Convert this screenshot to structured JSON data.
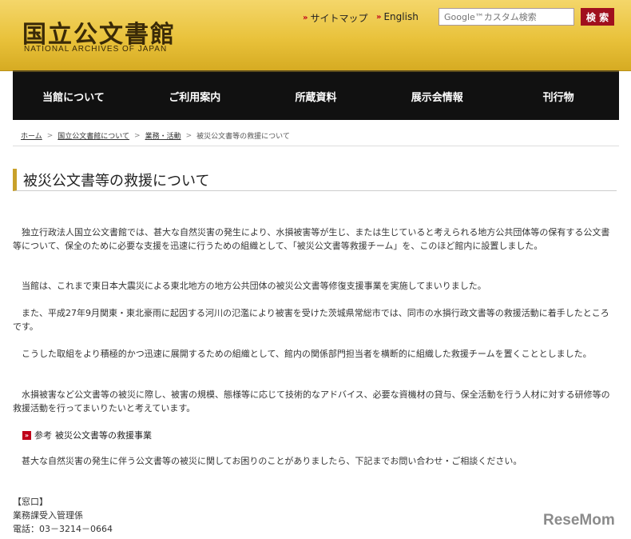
{
  "header": {
    "logo_jp": "国立公文書館",
    "logo_en": "NATIONAL ARCHIVES OF JAPAN",
    "sitemap_label": "サイトマップ",
    "english_label": "English",
    "search_placeholder": "Google™カスタム検索",
    "search_button": "検 索"
  },
  "nav": {
    "items": [
      "当館について",
      "ご利用案内",
      "所蔵資料",
      "展示会情報",
      "刊行物"
    ]
  },
  "breadcrumb": {
    "items": [
      "ホーム",
      "国立公文書館について",
      "業務・活動",
      "被災公文書等の救援について"
    ],
    "separator": ">"
  },
  "page": {
    "title": "被災公文書等の救援について",
    "paragraphs": [
      "独立行政法人国立公文書館では、甚大な自然災害の発生により、水損被害等が生じ、または生じていると考えられる地方公共団体等の保有する公文書等について、保全のために必要な支援を迅速に行うための組織として、「被災公文書等救援チーム」を、このほど館内に設置しました。",
      "当館は、これまで東日本大震災による東北地方の地方公共団体の被災公文書等修復支援事業を実施してまいりました。",
      "また、平成27年9月関東・東北豪雨に起因する河川の氾濫により被害を受けた茨城県常総市では、同市の水損行政文書等の救援活動に着手したところです。",
      "こうした取組をより積極的かつ迅速に展開するための組織として、館内の関係部門担当者を横断的に組織した救援チームを置くこととしました。",
      "水損被害など公文書等の被災に際し、被害の規模、態様等に応じて技術的なアドバイス、必要な資機材の貸与、保全活動を行う人材に対する研修等の救援活動を行ってまいりたいと考えています。"
    ],
    "reference_prefix": "参考",
    "reference_link": "被災公文書等の救援事業",
    "closing": "甚大な自然災害の発生に伴う公文書等の被災に関してお困りのことがありましたら、下記までお問い合わせ・ご相談ください。"
  },
  "contact": {
    "heading": "【窓口】",
    "department": "業務課受入管理係",
    "phone": "電話：03－3214－0664"
  },
  "watermark": {
    "text_a": "Rese",
    "text_b": "Mom"
  },
  "colors": {
    "header_gold": "#e9c23b",
    "nav_black": "#111111",
    "accent_red": "#c0001a",
    "title_bar": "#c9a12a"
  }
}
